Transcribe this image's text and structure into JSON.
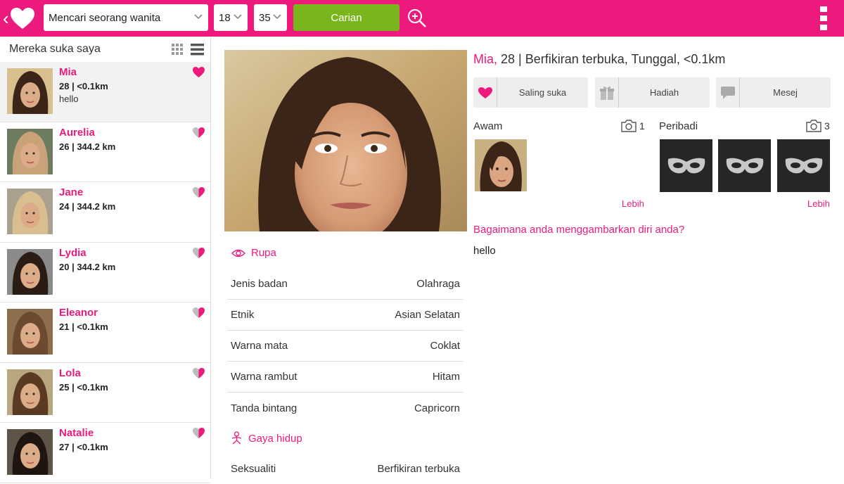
{
  "colors": {
    "brand": "#ec1a7c",
    "search_button": "#79b51c",
    "text_dark": "#222222"
  },
  "topbar": {
    "seeking_select": "Mencari seorang wanita",
    "age_min": "18",
    "age_max": "35",
    "search_label": "Carian"
  },
  "sidebar": {
    "title": "Mereka suka saya",
    "items": [
      {
        "name": "Mia",
        "meta": "28 | <0.1km",
        "message": "hello",
        "heart": "full"
      },
      {
        "name": "Aurelia",
        "meta": "26 | 344.2 km",
        "message": "",
        "heart": "half"
      },
      {
        "name": "Jane",
        "meta": "24 | 344.2 km",
        "message": "",
        "heart": "half"
      },
      {
        "name": "Lydia",
        "meta": "20 | 344.2 km",
        "message": "",
        "heart": "half"
      },
      {
        "name": "Eleanor",
        "meta": "21 | <0.1km",
        "message": "",
        "heart": "half"
      },
      {
        "name": "Lola",
        "meta": "25 | <0.1km",
        "message": "",
        "heart": "half"
      },
      {
        "name": "Natalie",
        "meta": "27 | <0.1km",
        "message": "",
        "heart": "half"
      }
    ]
  },
  "profile": {
    "name": "Mia,",
    "summary": " 28 | Berfikiran terbuka, Tunggal, <0.1km",
    "actions": {
      "like": "Saling suka",
      "gift": "Hadiah",
      "message": "Mesej"
    },
    "public_label": "Awam",
    "public_count": "1",
    "private_label": "Peribadi",
    "private_count": "3",
    "more": "Lebih",
    "question": "Bagaimana anda menggambarkan diri anda?",
    "answer": "hello"
  },
  "appearance": {
    "title": "Rupa",
    "rows": [
      {
        "label": "Jenis badan",
        "value": "Olahraga"
      },
      {
        "label": "Etnik",
        "value": "Asian Selatan"
      },
      {
        "label": "Warna mata",
        "value": "Coklat"
      },
      {
        "label": "Warna rambut",
        "value": "Hitam"
      },
      {
        "label": "Tanda bintang",
        "value": "Capricorn"
      }
    ]
  },
  "lifestyle": {
    "title": "Gaya hidup",
    "rows": [
      {
        "label": "Seksualiti",
        "value": "Berfikiran terbuka"
      }
    ]
  }
}
